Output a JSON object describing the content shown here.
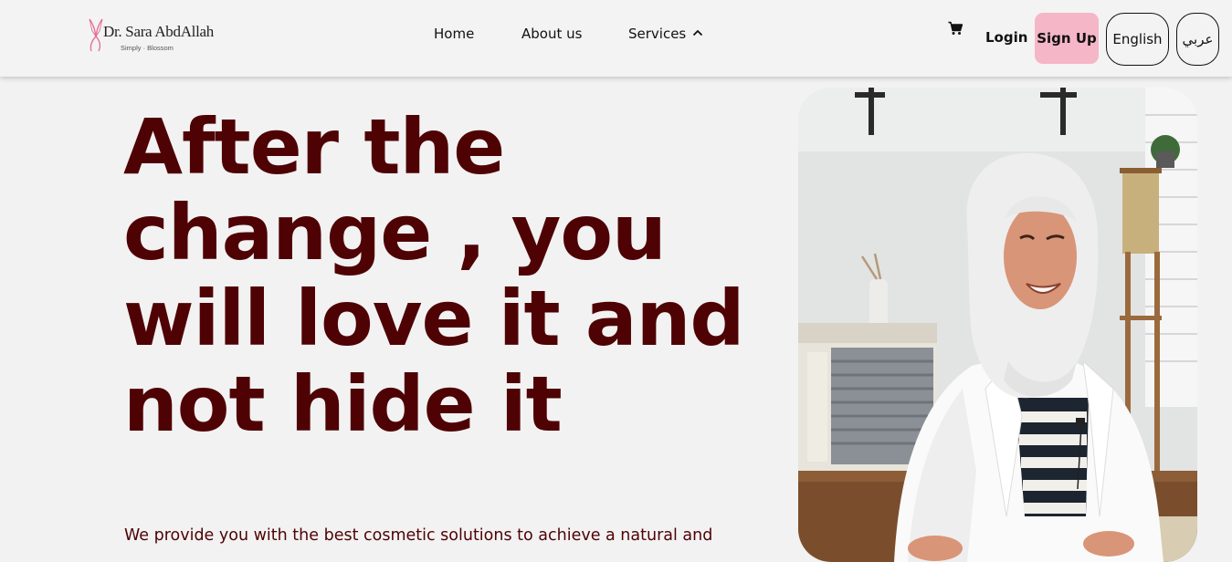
{
  "header": {
    "logo": {
      "name": "Dr. Sara AbdAllah",
      "tagline": "Simply · Blossom"
    },
    "nav": [
      {
        "label": "Home"
      },
      {
        "label": "About us"
      },
      {
        "label": "Services"
      }
    ],
    "login_label": "Login",
    "signup_label": "Sign Up",
    "languages": [
      "English",
      "عربي"
    ]
  },
  "hero": {
    "heading": "After the change , you will love it and not hide it",
    "subtext": "We provide you with the best cosmetic solutions to achieve a natural and"
  },
  "colors": {
    "accent_text": "#4f0204",
    "signup_bg": "#f5b6c8",
    "background": "#f2f2f2"
  },
  "icons": {
    "cart": "cart-icon",
    "services_toggle": "chevron-up-icon",
    "logo_mark": "butterfly-icon"
  }
}
